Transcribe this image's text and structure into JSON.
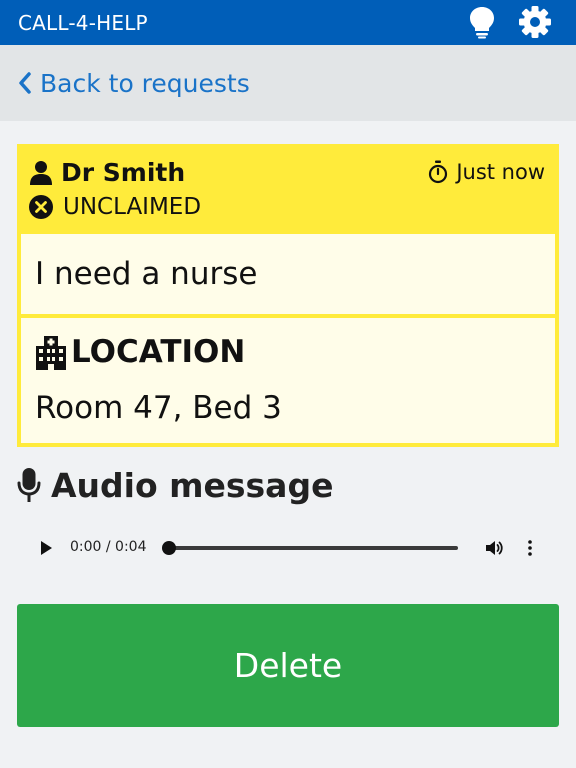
{
  "app": {
    "title": "CALL-4-HELP",
    "brand_color": "#005eb8"
  },
  "header": {
    "icons": [
      "lightbulb-icon",
      "gear-icon"
    ]
  },
  "nav": {
    "back_label": "Back to requests"
  },
  "request": {
    "requester": "Dr Smith",
    "time": "Just now",
    "status": "UNCLAIMED",
    "message": "I need a nurse",
    "location_label": "LOCATION",
    "location": "Room 47, Bed 3",
    "card_color": "#ffeb3b"
  },
  "audio": {
    "heading": "Audio message",
    "time_display": "0:00 / 0:04",
    "progress": 0
  },
  "actions": {
    "delete_label": "Delete",
    "delete_color": "#2da74a"
  }
}
